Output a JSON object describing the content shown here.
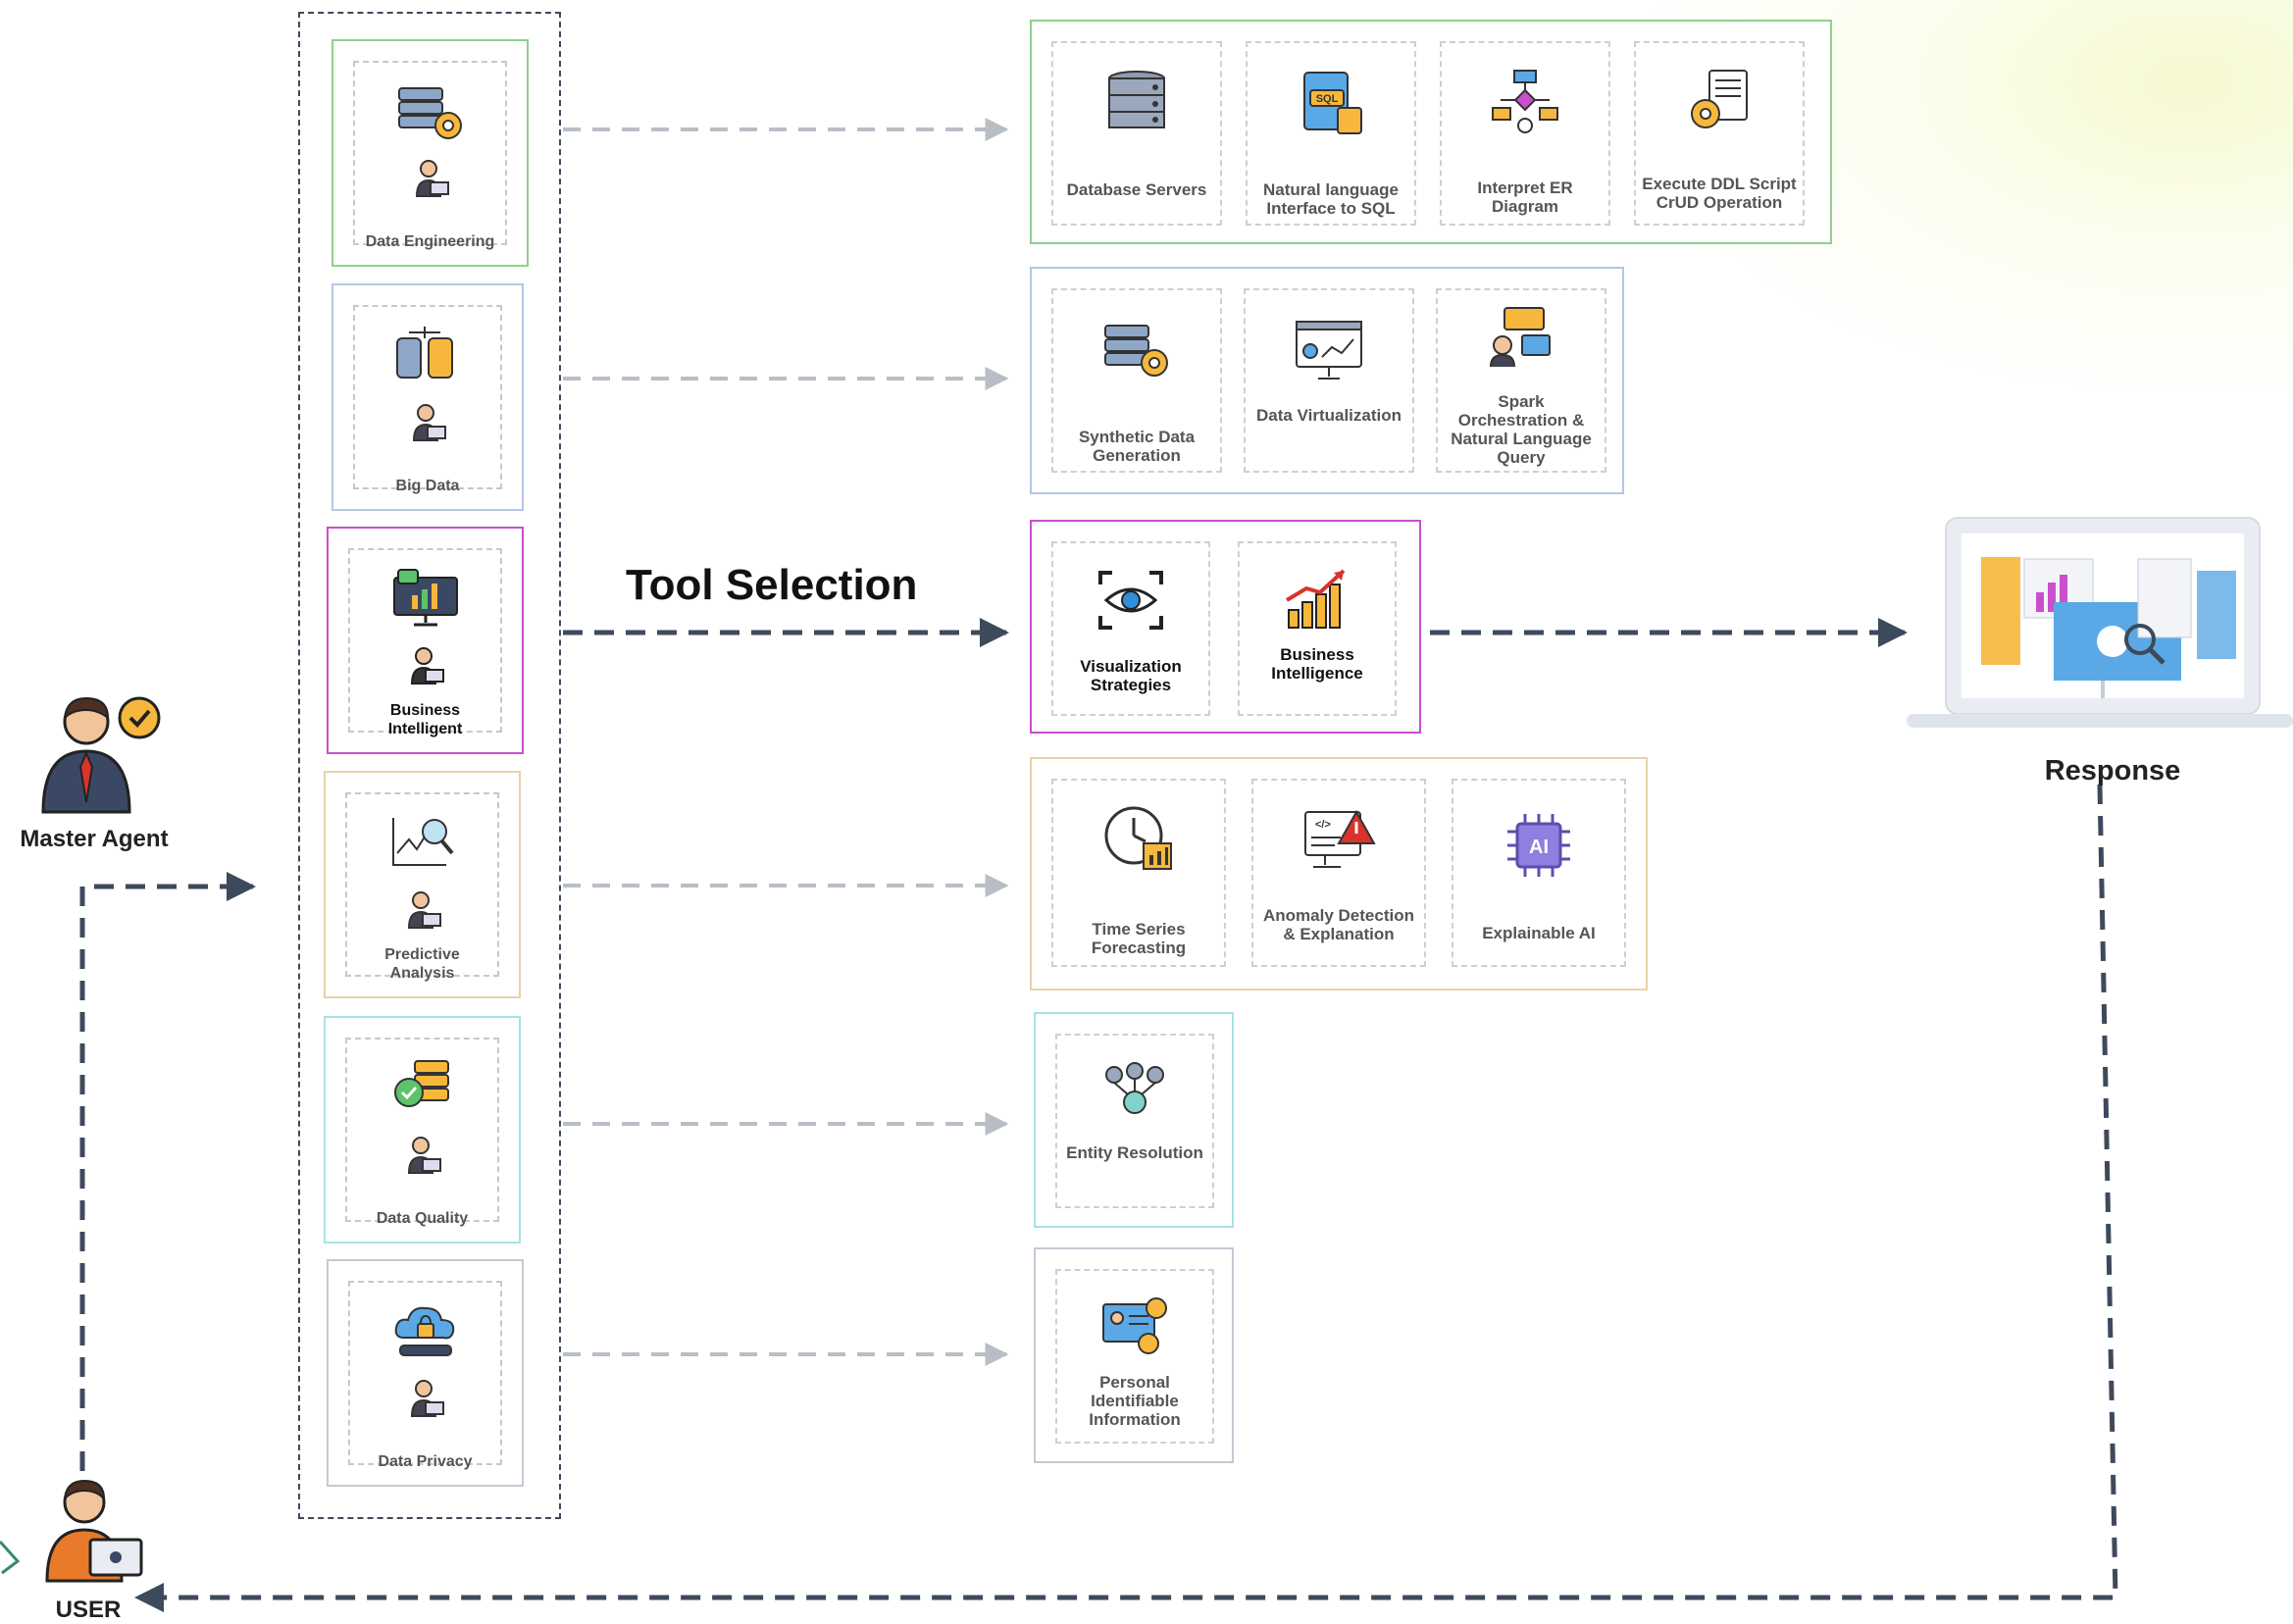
{
  "diagram": {
    "tool_selection_label": "Tool Selection",
    "response_label": "Response",
    "master_agent_label": "Master Agent",
    "user_label": "USER"
  },
  "agents": [
    {
      "label": "Data Engineering",
      "color": "#8fd18a",
      "active": false
    },
    {
      "label": "Big Data",
      "color": "#b4c6e6",
      "active": false
    },
    {
      "label": "Business Intelligent",
      "color": "#c94fcf",
      "active": true
    },
    {
      "label": "Predictive Analysis",
      "color": "#e7d3a8",
      "active": false
    },
    {
      "label": "Data Quality",
      "color": "#a7e2e4",
      "active": false
    },
    {
      "label": "Data Privacy",
      "color": "#c9c6d4",
      "active": false
    }
  ],
  "tool_groups": [
    {
      "color": "#8fd18a",
      "tools": [
        "Database Servers",
        "Natural language Interface to SQL",
        "Interpret ER Diagram",
        "Execute DDL Script CrUD Operation"
      ]
    },
    {
      "color": "#b4c6e6",
      "tools": [
        "Synthetic Data Generation",
        "Data Virtualization",
        "Spark Orchestration & Natural Language Query"
      ]
    },
    {
      "color": "#c94fcf",
      "tools": [
        "Visualization Strategies",
        "Business Intelligence"
      ]
    },
    {
      "color": "#e7d3a8",
      "tools": [
        "Time Series Forecasting",
        "Anomaly Detection & Explanation",
        "Explainable AI"
      ]
    },
    {
      "color": "#a7e2e4",
      "tools": [
        "Entity Resolution"
      ]
    },
    {
      "color": "#c9c6d4",
      "tools": [
        "Personal Identifiable Information"
      ]
    }
  ],
  "colors": {
    "arrow_active": "#3d4a5c",
    "arrow_inactive": "#b9bec6"
  },
  "icons": [
    "database-gear-icon",
    "person-laptop-icon",
    "database-stack-icon",
    "monitor-chart-icon",
    "chart-magnifier-icon",
    "database-badge-icon",
    "cloud-lock-icon",
    "server-cylinders-icon",
    "sql-database-icon",
    "flowchart-icon",
    "document-gear-icon",
    "monitor-dashboard-icon",
    "people-chat-icon",
    "eye-scan-icon",
    "growth-chart-icon",
    "clock-chart-icon",
    "code-warning-icon",
    "ai-chip-icon",
    "network-people-icon",
    "id-card-shield-icon",
    "laptop-dashboard-icon",
    "master-agent-icon",
    "user-laptop-icon"
  ]
}
